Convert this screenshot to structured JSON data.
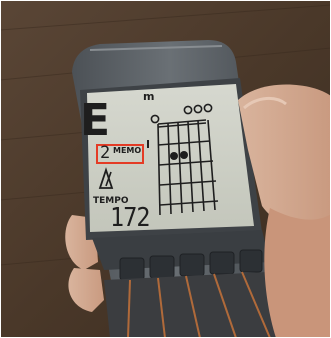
{
  "display": {
    "chord_root": "E",
    "chord_quality": "m",
    "memo_number": "2",
    "memo_label": "MEMO",
    "tempo_label": "TEMPO",
    "tempo_value": "172"
  },
  "colors": {
    "highlight_box": "#e43b25",
    "lcd_background": "#cfd2c8",
    "lcd_segment": "#1e1e1e",
    "device_body": "#5b6166",
    "wood_background": "#4e3a2b"
  },
  "icons": [
    "metronome-icon",
    "chord-diagram"
  ]
}
